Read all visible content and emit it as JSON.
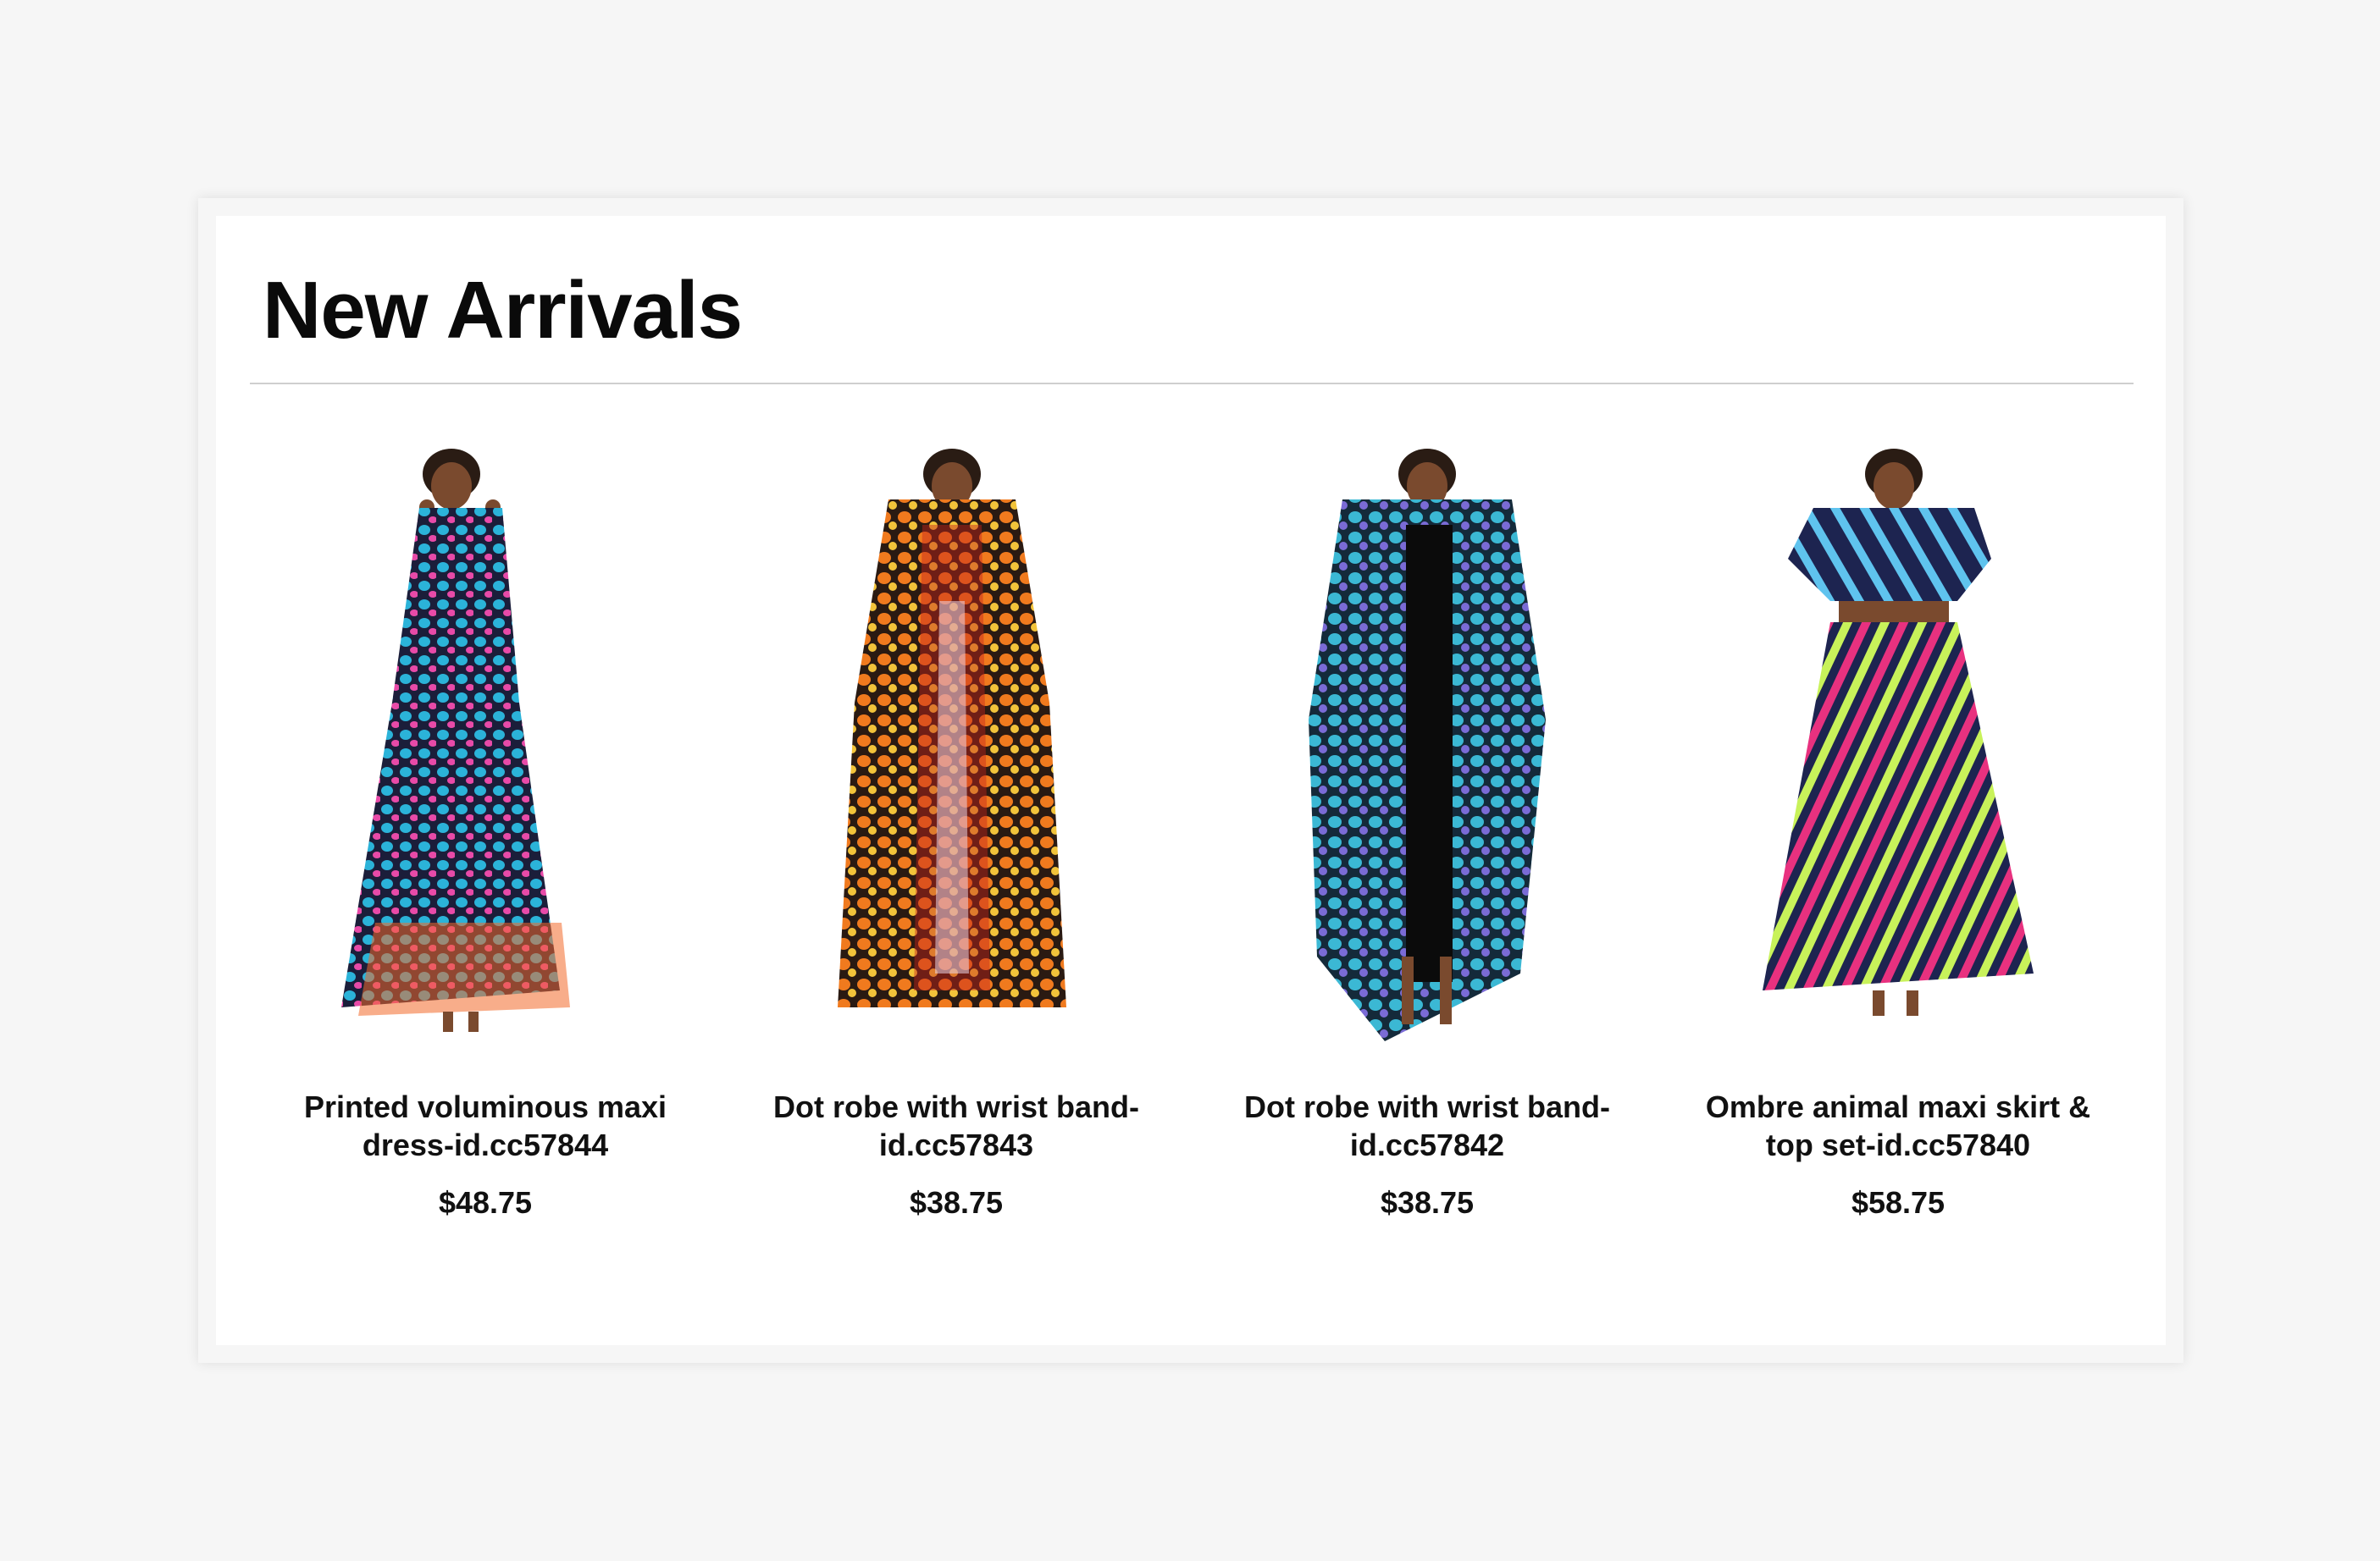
{
  "section": {
    "title": "New Arrivals"
  },
  "products": [
    {
      "name": "Printed voluminous maxi dress-id.cc57844",
      "price": "$48.75",
      "palette": [
        "#2bb3d9",
        "#1b1e3a",
        "#e84aa8",
        "#f26a2a"
      ]
    },
    {
      "name": "Dot robe with wrist band-id.cc57843",
      "price": "$38.75",
      "palette": [
        "#f07a1e",
        "#c6241c",
        "#f2c33a",
        "#2a1a12"
      ]
    },
    {
      "name": "Dot robe with wrist band-id.cc57842",
      "price": "$38.75",
      "palette": [
        "#3bb8d4",
        "#142a3a",
        "#7a6bd6",
        "#0b0b0b"
      ]
    },
    {
      "name": "Ombre animal maxi skirt & top set-id.cc57840",
      "price": "$58.75",
      "palette": [
        "#1d2450",
        "#e8317f",
        "#c8f25a",
        "#5fc3ee"
      ]
    }
  ]
}
